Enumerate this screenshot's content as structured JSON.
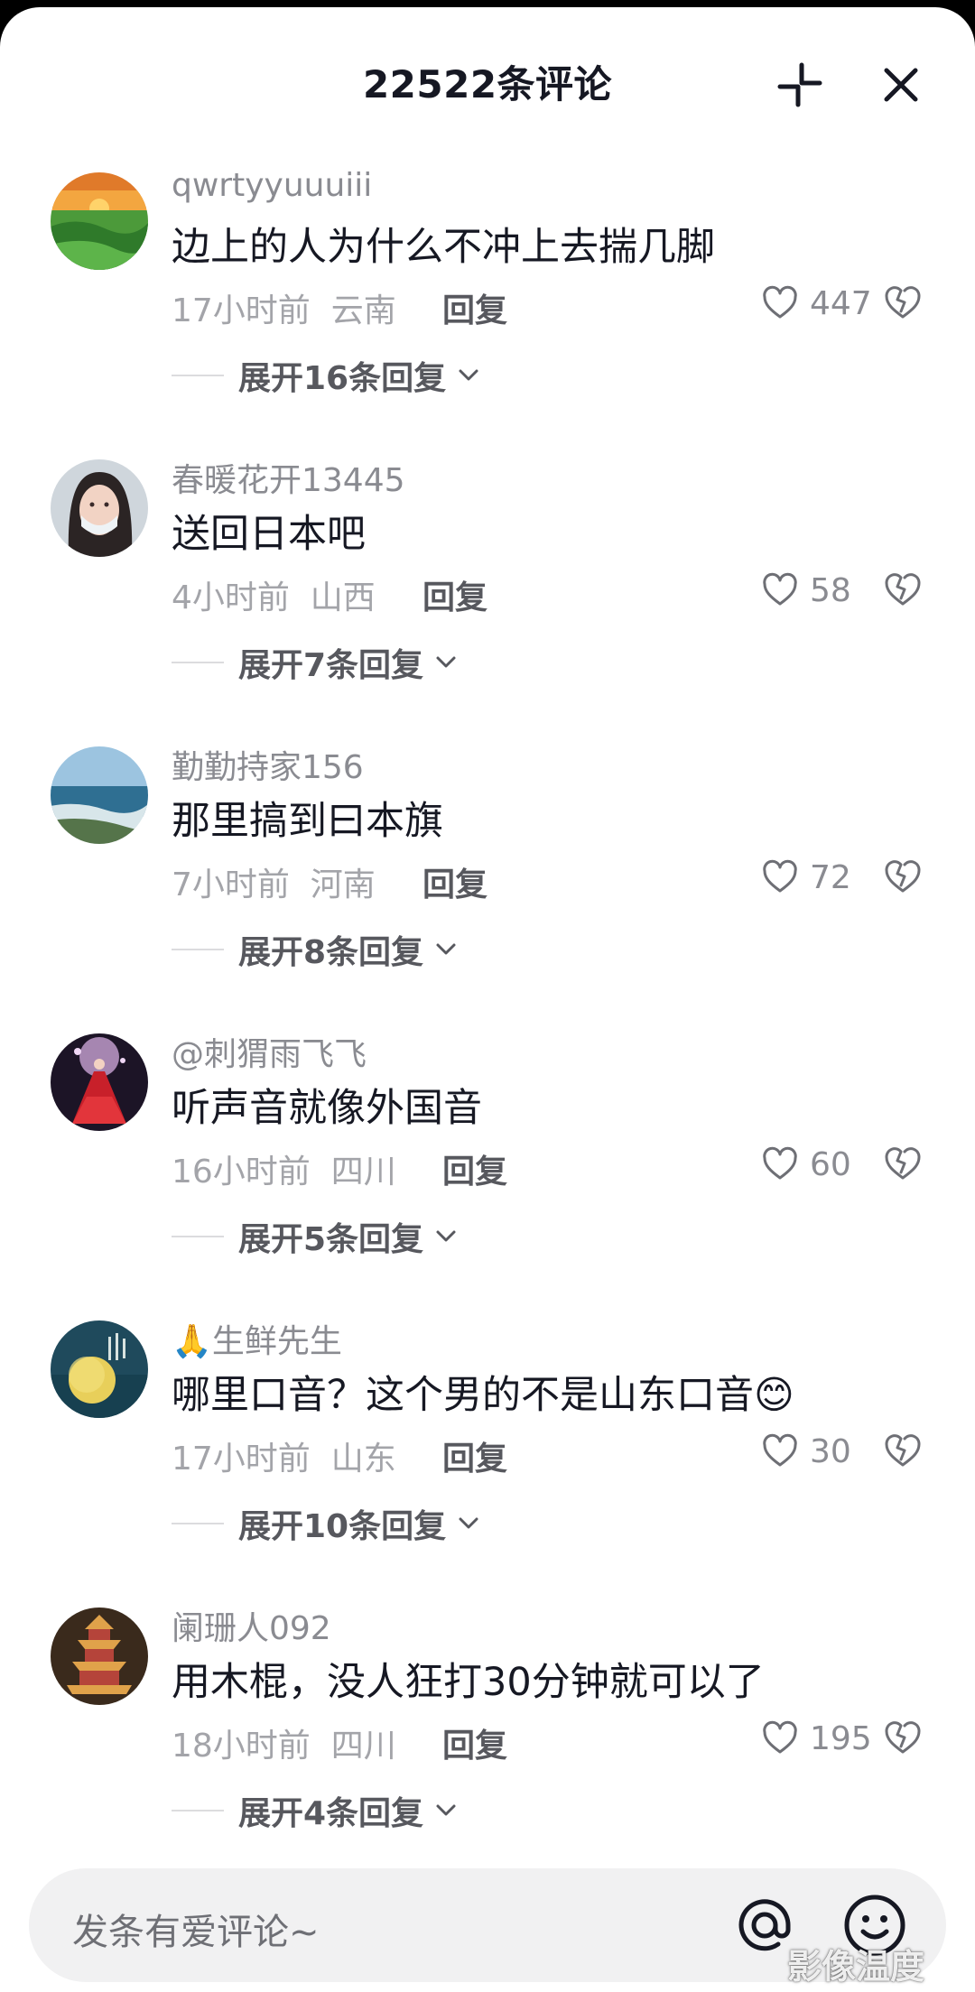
{
  "header": {
    "title": "22522条评论",
    "collapse_icon": "collapse-icon",
    "close_icon": "close-icon"
  },
  "comments": [
    {
      "username": "qwrtyyuuuiii",
      "text": "边上的人为什么不冲上去揣几脚",
      "time": "17小时前",
      "location": "云南",
      "reply_label": "回复",
      "likes": "447",
      "expand_label": "展开16条回复",
      "avatar_icon": "landscape-sunset-avatar"
    },
    {
      "username": "春暖花开13445",
      "text": "送回日本吧",
      "time": "4小时前",
      "location": "山西",
      "reply_label": "回复",
      "likes": "58",
      "expand_label": "展开7条回复",
      "avatar_icon": "woman-portrait-avatar"
    },
    {
      "username": "勤勤持家156",
      "text": "那里搞到曰本旗",
      "time": "7小时前",
      "location": "河南",
      "reply_label": "回复",
      "likes": "72",
      "expand_label": "展开8条回复",
      "avatar_icon": "seaside-avatar"
    },
    {
      "username": "@刺猬雨飞飞",
      "text": "听声音就像外国音",
      "time": "16小时前",
      "location": "四川",
      "reply_label": "回复",
      "likes": "60",
      "expand_label": "展开5条回复",
      "avatar_icon": "red-dress-avatar"
    },
    {
      "username": "🙏生鲜先生",
      "text": "哪里口音？这个男的不是山东口音😊",
      "time": "17小时前",
      "location": "山东",
      "reply_label": "回复",
      "likes": "30",
      "expand_label": "展开10条回复",
      "avatar_icon": "moon-night-avatar"
    },
    {
      "username": "阑珊人092",
      "text": "用木棍，没人狂打30分钟就可以了",
      "time": "18小时前",
      "location": "四川",
      "reply_label": "回复",
      "likes": "195",
      "expand_label": "展开4条回复",
      "avatar_icon": "pagoda-avatar"
    }
  ],
  "input": {
    "placeholder": "发条有爱评论~",
    "at_icon": "at-icon",
    "emoji_icon": "emoji-icon"
  },
  "watermark": "影像温度"
}
